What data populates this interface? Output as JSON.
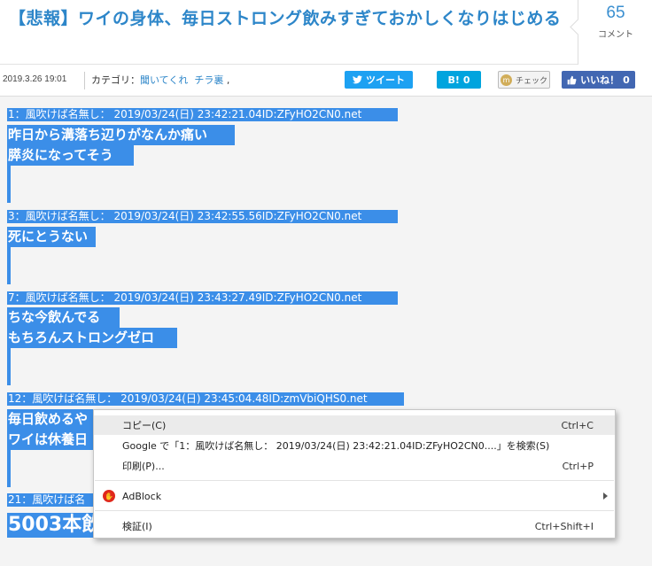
{
  "header": {
    "title": "【悲報】ワイの身体、毎日ストロング飲みすぎておかしくなりはじめる",
    "comment_count": "65",
    "comment_label": "コメント"
  },
  "meta": {
    "date": "2019.3.26 19:01",
    "category_prefix": "カテゴリ：",
    "category_1": "聞いてくれ",
    "category_2": "チラ裏",
    "category_suffix": " ,",
    "tweet_label": "ツイート",
    "hatena_label": "B!",
    "hatena_count": "0",
    "mixi_label": "チェック",
    "like_label": "いいね！",
    "like_count": "0"
  },
  "posts": [
    {
      "header": "1：風吹けば名無し： 2019/03/24(日) 23:42:21.04ID:ZFyHO2CN0.net",
      "lines": [
        "昨日から溝落ち辺りがなんか痛い",
        "膵炎になってそう"
      ]
    },
    {
      "header": "3：風吹けば名無し： 2019/03/24(日) 23:42:55.56ID:ZFyHO2CN0.net",
      "lines": [
        "死にとうない"
      ]
    },
    {
      "header": "7：風吹けば名無し： 2019/03/24(日) 23:43:27.49ID:ZFyHO2CN0.net",
      "lines": [
        "ちな今飲んでる",
        "もちろんストロングゼロ"
      ]
    },
    {
      "header": "12：風吹けば名無し： 2019/03/24(日) 23:45:04.48ID:zmVbiQHS0.net",
      "lines": [
        "毎日飲めるや",
        "ワイは休養日"
      ]
    },
    {
      "header": "21：風吹けば名",
      "lines": [
        "5003本飲"
      ]
    }
  ],
  "context_menu": {
    "copy": "コピー(C)",
    "copy_shortcut": "Ctrl+C",
    "google": "Google で「1：風吹けば名無し： 2019/03/24(日) 23:42:21.04ID:ZFyHO2CN0....」を検索(S)",
    "print": "印刷(P)...",
    "print_shortcut": "Ctrl+P",
    "adblock": "AdBlock",
    "inspect": "検証(I)",
    "inspect_shortcut": "Ctrl+Shift+I"
  }
}
